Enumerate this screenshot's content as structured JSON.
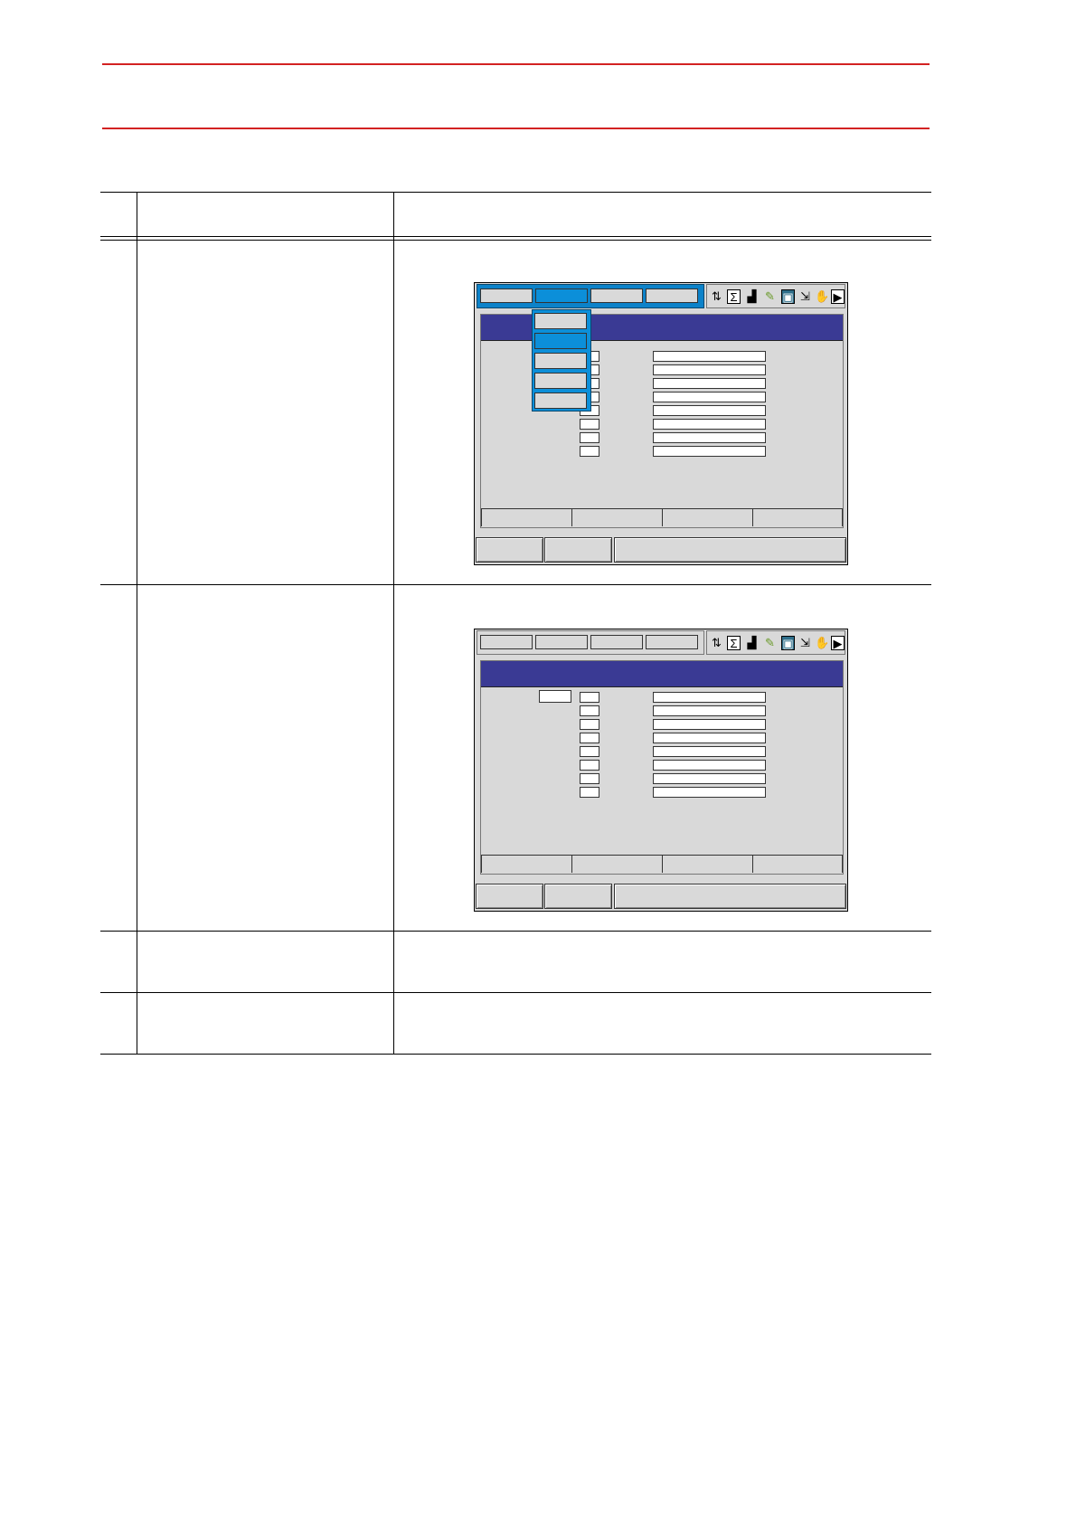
{
  "header": {
    "rule_color": "#d32222"
  },
  "table": {
    "columns": [
      "",
      "",
      ""
    ],
    "rows": [
      {
        "step": "",
        "operation": "",
        "explanation": ""
      },
      {
        "step": "",
        "operation": "",
        "explanation": ""
      },
      {
        "step": "",
        "operation": "",
        "explanation": ""
      },
      {
        "step": "",
        "operation": "",
        "explanation": ""
      }
    ]
  },
  "screens": [
    {
      "menu_state": "open",
      "accent_color": "#0c82c9",
      "title_color": "#3a3a94",
      "status_icons": [
        "job-edit-icon",
        "sigma-icon",
        "signal-icon",
        "tool-icon",
        "storage-icon",
        "export-icon",
        "hand-icon",
        "play-icon"
      ],
      "dropdown_items": 5,
      "dropdown_selected": 2
    },
    {
      "menu_state": "closed",
      "accent_color": "#0c82c9",
      "title_color": "#3a3a94",
      "status_icons": [
        "job-edit-icon",
        "sigma-icon",
        "signal-icon",
        "tool-icon",
        "storage-icon",
        "export-icon",
        "hand-icon",
        "play-icon"
      ]
    }
  ]
}
